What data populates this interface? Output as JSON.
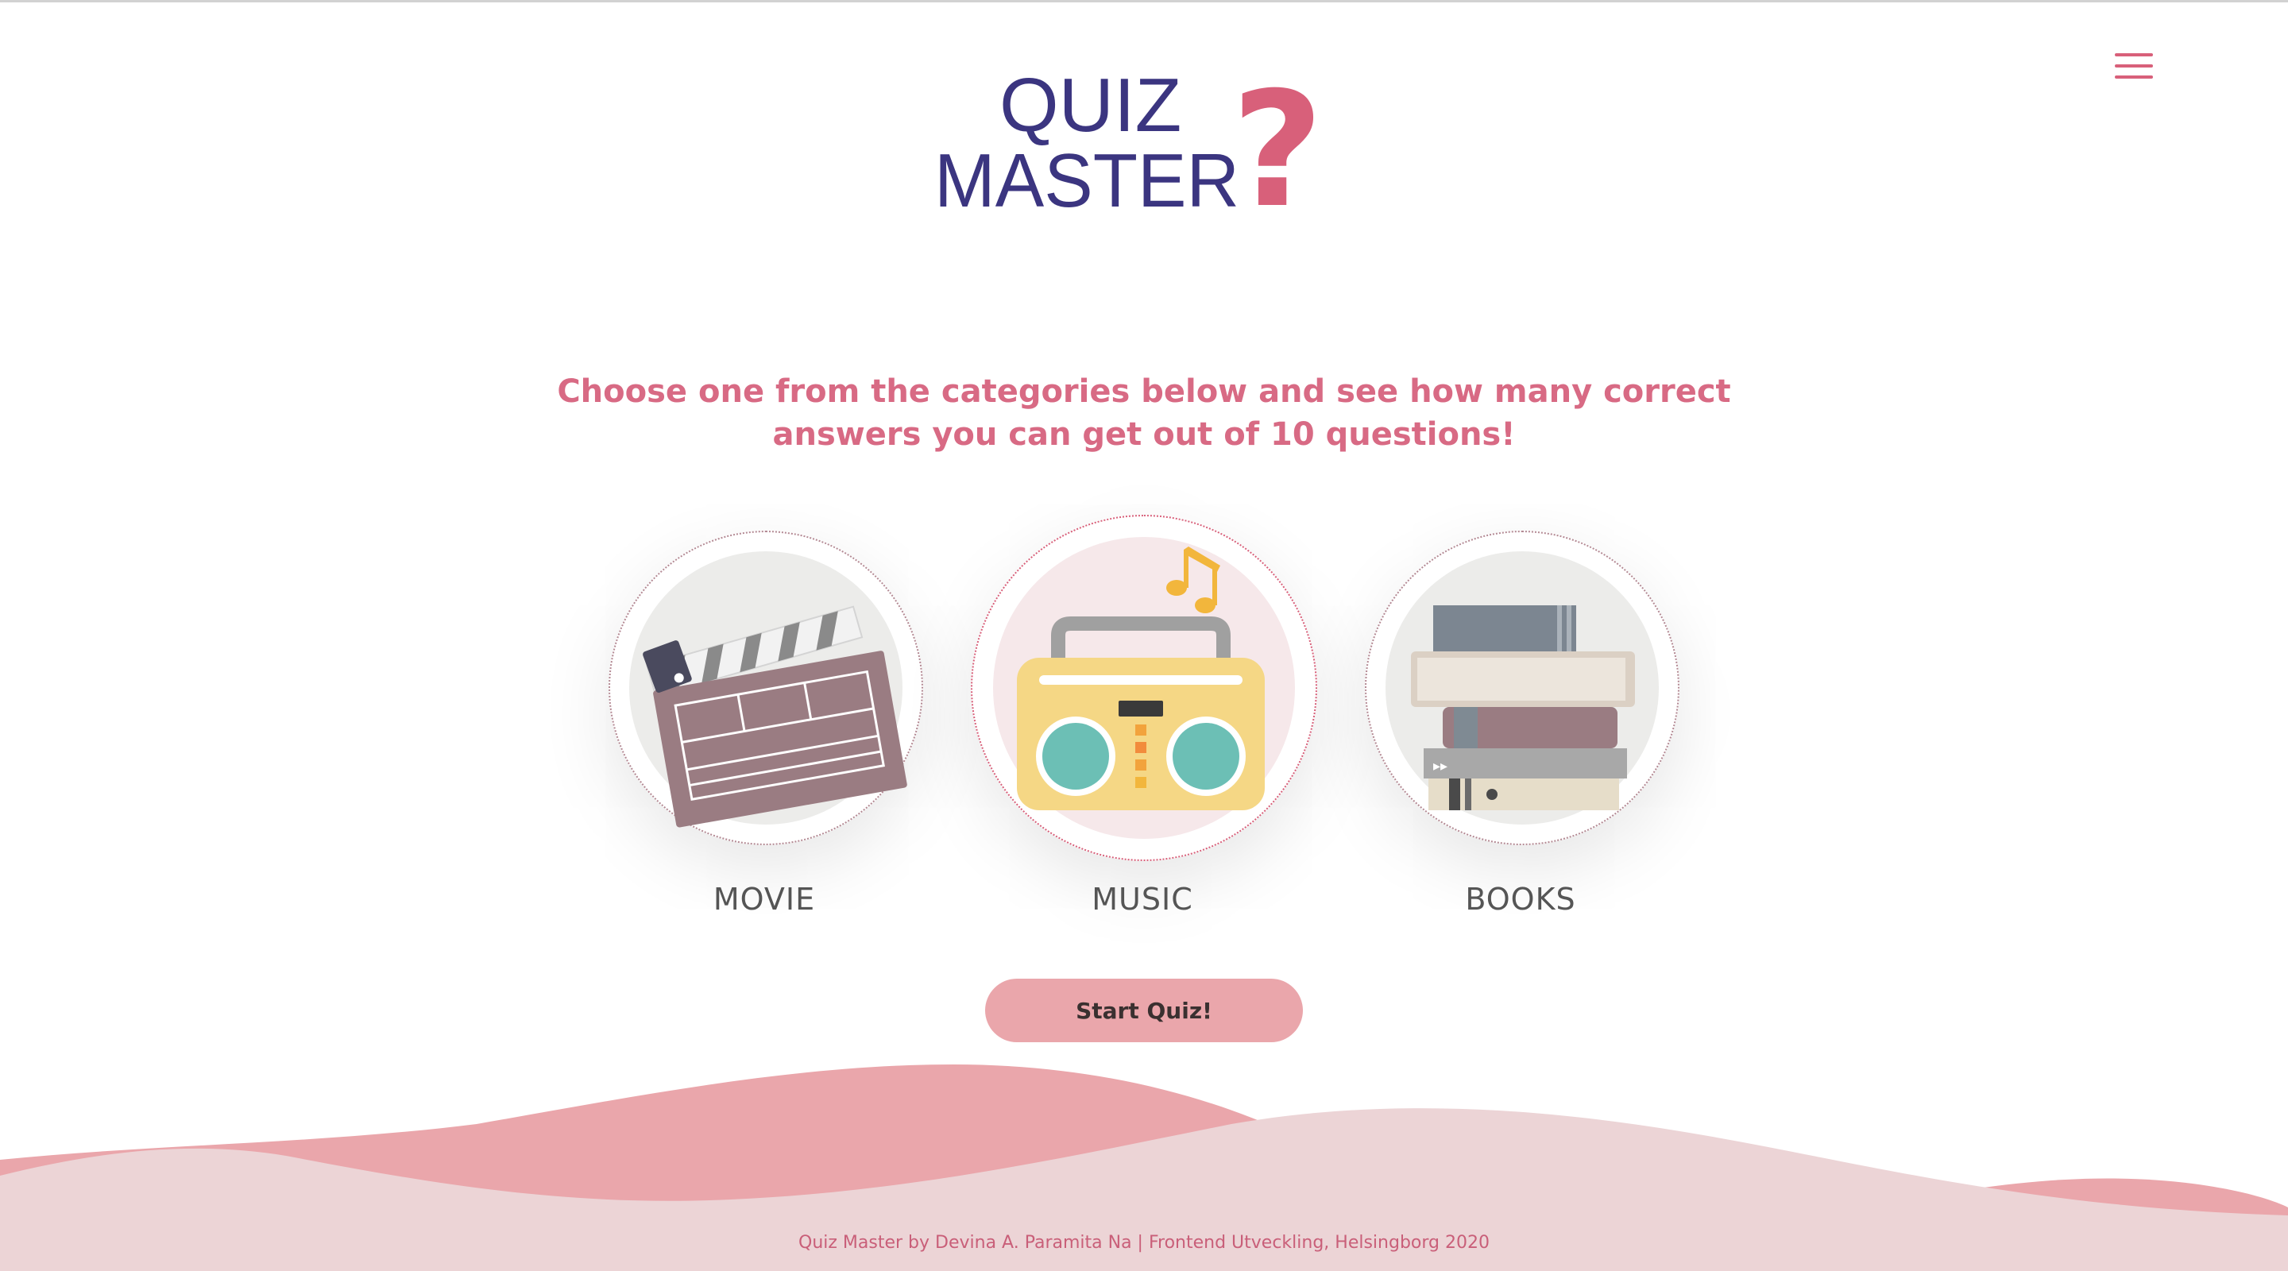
{
  "header": {
    "logo_line1": "QUIZ",
    "logo_line2": "MASTER",
    "logo_mark": "?",
    "menu_icon": "hamburger-icon"
  },
  "intro": {
    "text": "Choose one from the categories below and see how many correct answers you can get out of 10 questions!"
  },
  "categories": [
    {
      "label": "MOVIE",
      "icon": "clapperboard-icon",
      "selected": false
    },
    {
      "label": "MUSIC",
      "icon": "boombox-icon",
      "selected": true
    },
    {
      "label": "BOOKS",
      "icon": "books-stack-icon",
      "selected": false
    }
  ],
  "actions": {
    "start_label": "Start Quiz!"
  },
  "footer": {
    "text": "Quiz Master by Devina A. Paramita Na | Frontend Utveckling, Helsingborg 2020"
  },
  "colors": {
    "brand_navy": "#3b3580",
    "accent_pink": "#d86a84",
    "button_pink": "#eaa6ab",
    "wave_dark": "#eaa6ab",
    "wave_light": "#ecd4d6",
    "music_note": "#f2b63c"
  }
}
